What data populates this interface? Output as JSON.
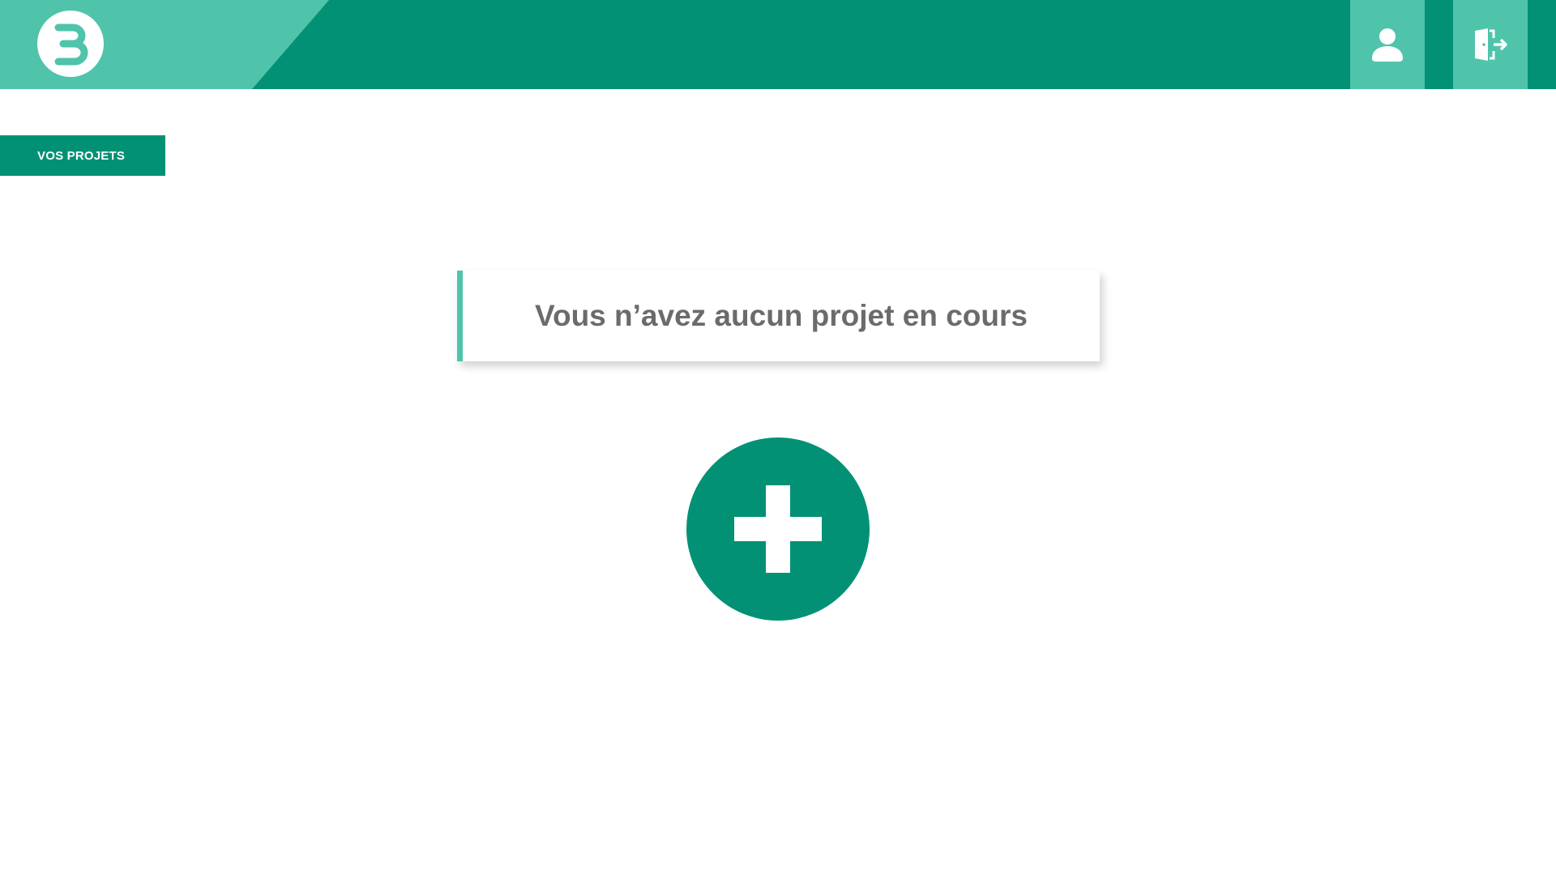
{
  "header": {
    "logo_icon": "b-logo-icon",
    "user_button_icon": "user-icon",
    "logout_button_icon": "logout-door-icon",
    "colors": {
      "dark": "#039175",
      "light": "#4fc4aa"
    }
  },
  "nav": {
    "projects_tab_label": "VOS PROJETS"
  },
  "main": {
    "empty_message": "Vous n’avez aucun projet en cours",
    "add_button_icon": "plus-icon"
  }
}
